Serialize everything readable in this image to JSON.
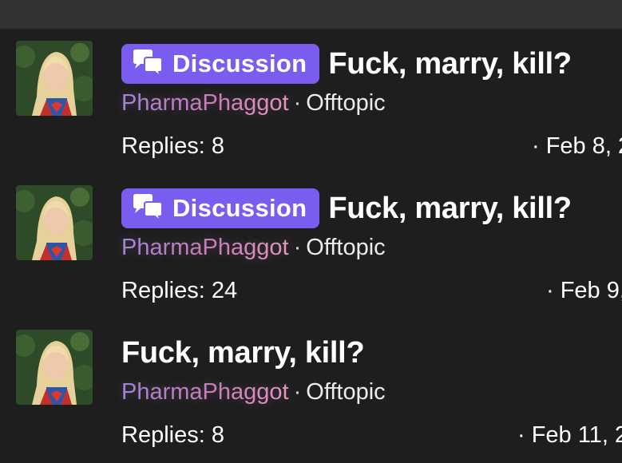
{
  "threads": [
    {
      "badge_label": "Discussion",
      "title": "Fuck, marry, kill?",
      "author": "PharmaPhaggot",
      "separator": "·",
      "forum": "Offtopic",
      "replies": "Replies: 8",
      "date": "· Feb 8, 2"
    },
    {
      "badge_label": "Discussion",
      "title": "Fuck, marry, kill?",
      "author": "PharmaPhaggot",
      "separator": "·",
      "forum": "Offtopic",
      "replies": "Replies: 24",
      "date": "· Feb 9,"
    },
    {
      "badge_label": "",
      "title": "Fuck, marry, kill?",
      "author": "PharmaPhaggot",
      "separator": "·",
      "forum": "Offtopic",
      "replies": "Replies: 8",
      "date": "· Feb 11, 2"
    }
  ],
  "colors": {
    "background": "#1e1e1f",
    "badge": "#7b5cf0",
    "author_gradient_start": "#9b86d8",
    "author_gradient_end": "#e59ac0"
  },
  "icons": {
    "badge_icon": "speech-bubbles-icon"
  }
}
